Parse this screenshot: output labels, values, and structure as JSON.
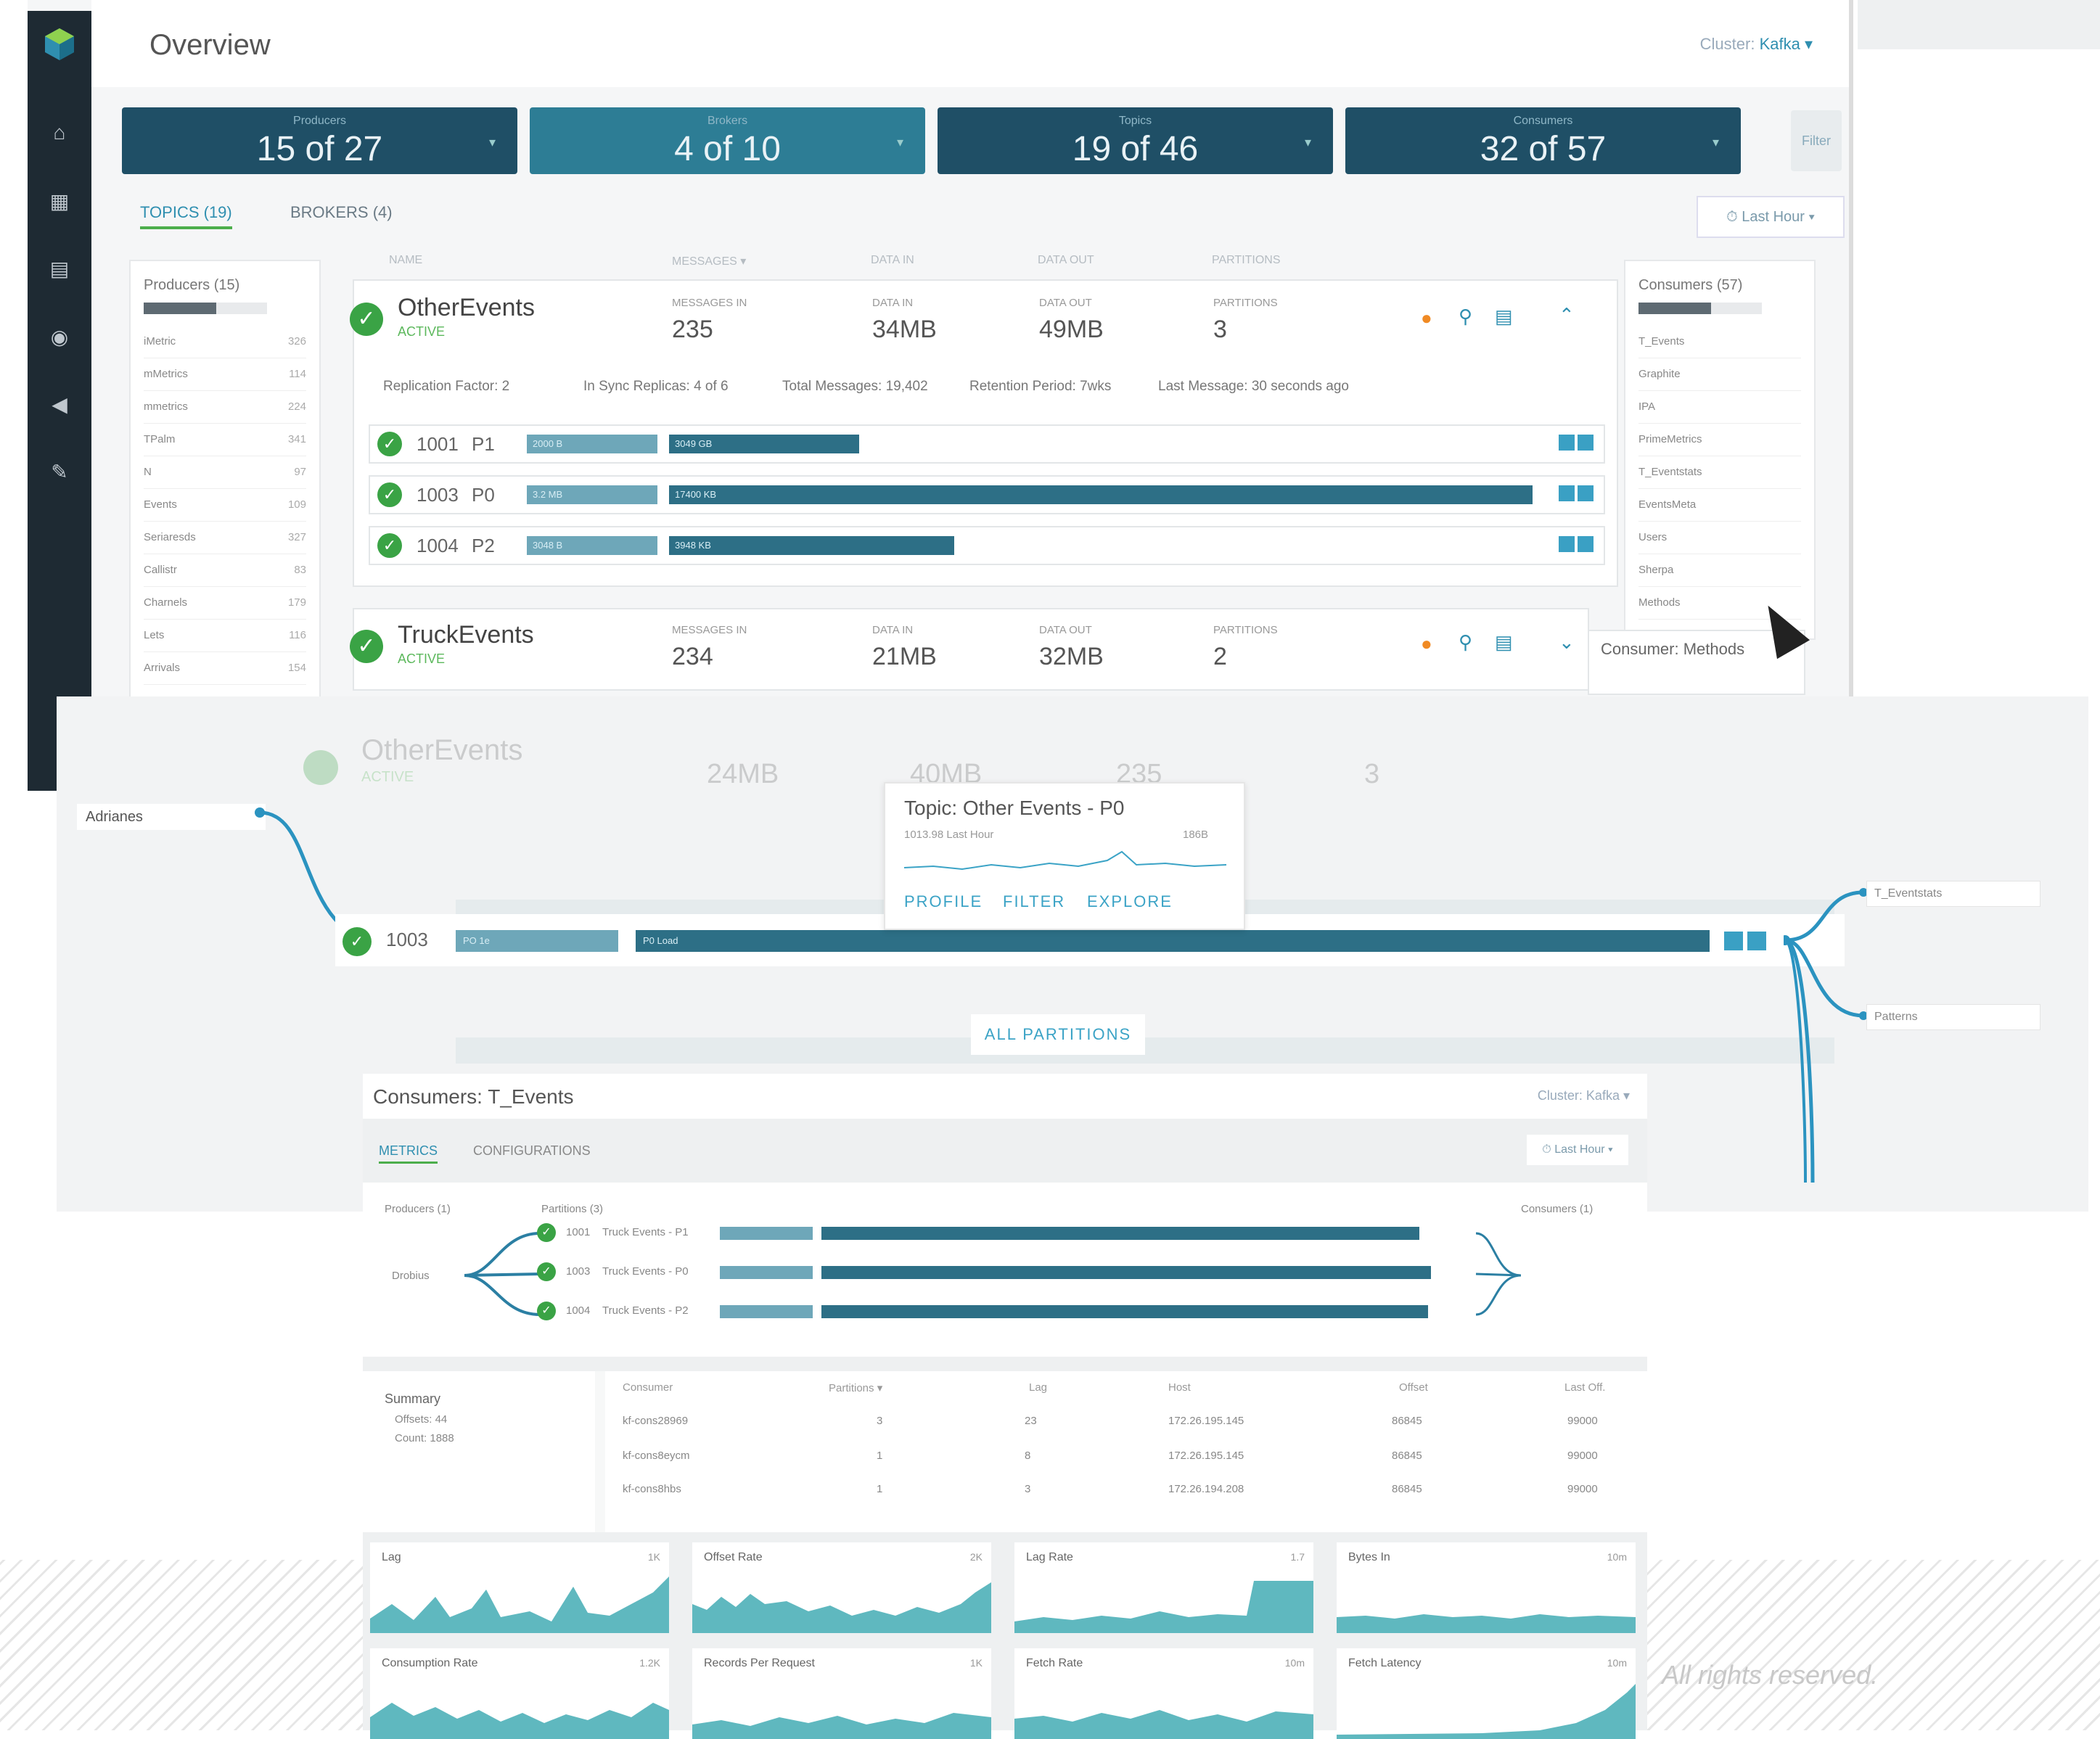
{
  "app": {
    "title": "Overview",
    "cluster_label": "Cluster:",
    "cluster_value": "Kafka ▾"
  },
  "kpis": [
    {
      "label": "Producers",
      "value": "15 of 27"
    },
    {
      "label": "Brokers",
      "value": "4 of 10"
    },
    {
      "label": "Topics",
      "value": "19 of 46"
    },
    {
      "label": "Consumers",
      "value": "32 of 57"
    }
  ],
  "filter_label": "Filter",
  "tabs": {
    "topics": "TOPICS (19)",
    "brokers": "BROKERS (4)"
  },
  "time_range": "⏱ Last Hour ▾",
  "column_headers": [
    "NAME",
    "MESSAGES ▾",
    "DATA IN",
    "DATA OUT",
    "PARTITIONS"
  ],
  "producers_panel": {
    "title": "Producers (15)",
    "items": [
      {
        "name": "iMetric",
        "value": "326"
      },
      {
        "name": "mMetrics",
        "value": "114"
      },
      {
        "name": "mmetrics",
        "value": "224"
      },
      {
        "name": "TPalm",
        "value": "341"
      },
      {
        "name": "N",
        "value": "97"
      },
      {
        "name": "Events",
        "value": "109"
      },
      {
        "name": "Seriaresds",
        "value": "327"
      },
      {
        "name": "Callistr",
        "value": "83"
      },
      {
        "name": "Charnels",
        "value": "179"
      },
      {
        "name": "Lets",
        "value": "116"
      },
      {
        "name": "Arrivals",
        "value": "154"
      }
    ]
  },
  "consumers_panel": {
    "title": "Consumers (57)",
    "items": [
      {
        "name": "T_Events"
      },
      {
        "name": "Graphite"
      },
      {
        "name": "IPA"
      },
      {
        "name": "PrimeMetrics"
      },
      {
        "name": "T_Eventstats"
      },
      {
        "name": "EventsMeta"
      },
      {
        "name": "Users"
      },
      {
        "name": "Sherpa"
      },
      {
        "name": "Methods"
      }
    ],
    "tooltip": "Consumer: Methods"
  },
  "topics": [
    {
      "name": "OtherEvents",
      "status": "ACTIVE",
      "metrics": [
        {
          "label": "MESSAGES IN",
          "value": "235"
        },
        {
          "label": "DATA IN",
          "value": "34MB"
        },
        {
          "label": "DATA OUT",
          "value": "49MB"
        },
        {
          "label": "PARTITIONS",
          "value": "3"
        }
      ],
      "info": [
        "Replication Factor: 2",
        "In Sync Replicas: 4 of 6",
        "Total Messages: 19,402",
        "Retention Period: 7wks",
        "Last Message: 30 seconds ago"
      ],
      "partitions": [
        {
          "id": "1001",
          "p": "P1",
          "bar1": "2000 B",
          "bar2": "3049 GB",
          "fill": 0.22
        },
        {
          "id": "1003",
          "p": "P0",
          "bar1": "3.2 MB",
          "bar2": "17400 KB",
          "fill": 1.0
        },
        {
          "id": "1004",
          "p": "P2",
          "bar1": "3048 B",
          "bar2": "3948 KB",
          "fill": 0.33
        }
      ]
    },
    {
      "name": "TruckEvents",
      "status": "ACTIVE",
      "metrics": [
        {
          "label": "MESSAGES IN",
          "value": "234"
        },
        {
          "label": "DATA IN",
          "value": "21MB"
        },
        {
          "label": "DATA OUT",
          "value": "32MB"
        },
        {
          "label": "PARTITIONS",
          "value": "2"
        }
      ]
    }
  ],
  "overlay": {
    "topic_name": "OtherEvents",
    "topic_status": "ACTIVE",
    "metrics": [
      "24MB",
      "40MB",
      "235",
      "3"
    ],
    "highlight_producer": "Adrianes",
    "partition_id": "1003",
    "partition_bar1": "PO 1e",
    "partition_bar2": "P0 Load",
    "consumer_a": "T_Eventstats",
    "consumer_b": "Patterns",
    "tooltip": {
      "title": "Topic: Other Events - P0",
      "subtitle": "1013.98   Last Hour",
      "subvalue": "186B",
      "links": [
        "PROFILE",
        "FILTER",
        "EXPLORE"
      ]
    },
    "all_partitions": "ALL PARTITIONS"
  },
  "consumer_detail": {
    "title": "Consumers: T_Events",
    "cluster": "Cluster: Kafka ▾",
    "tabs": [
      "METRICS",
      "CONFIGURATIONS"
    ],
    "time": "⏱ Last Hour ▾",
    "labels": {
      "producers": "Producers (1)",
      "partitions": "Partitions (3)",
      "consumers": "Consumers (1)"
    },
    "producer": "Drobius",
    "flow_rows": [
      {
        "id": "1001",
        "topic": "Truck Events - P1"
      },
      {
        "id": "1003",
        "topic": "Truck Events - P0"
      },
      {
        "id": "1004",
        "topic": "Truck Events - P2"
      }
    ],
    "summary_title": "Summary",
    "summary_lines": [
      "Offsets: 44",
      "Count: 1888"
    ],
    "table_headers": [
      "Consumer",
      "Partitions ▾",
      "Lag",
      "Host",
      "Offset",
      "Last Off."
    ],
    "table_rows": [
      [
        "kf-cons28969",
        "3",
        "23",
        "172.26.195.145",
        "86845",
        "99000"
      ],
      [
        "kf-cons8eycm",
        "1",
        "8",
        "172.26.195.145",
        "86845",
        "99000"
      ],
      [
        "kf-cons8hbs",
        "1",
        "3",
        "172.26.194.208",
        "86845",
        "99000"
      ]
    ],
    "sparklines": [
      {
        "title": "Lag",
        "value": "1K"
      },
      {
        "title": "Offset Rate",
        "value": "2K"
      },
      {
        "title": "Lag Rate",
        "value": "1.7"
      },
      {
        "title": "Bytes In",
        "value": "10m"
      },
      {
        "title": "Consumption Rate",
        "value": "1.2K"
      },
      {
        "title": "Records Per Request",
        "value": "1K"
      },
      {
        "title": "Fetch Rate",
        "value": "10m"
      },
      {
        "title": "Fetch Latency",
        "value": "10m"
      }
    ]
  },
  "footer": "All rights reserved."
}
